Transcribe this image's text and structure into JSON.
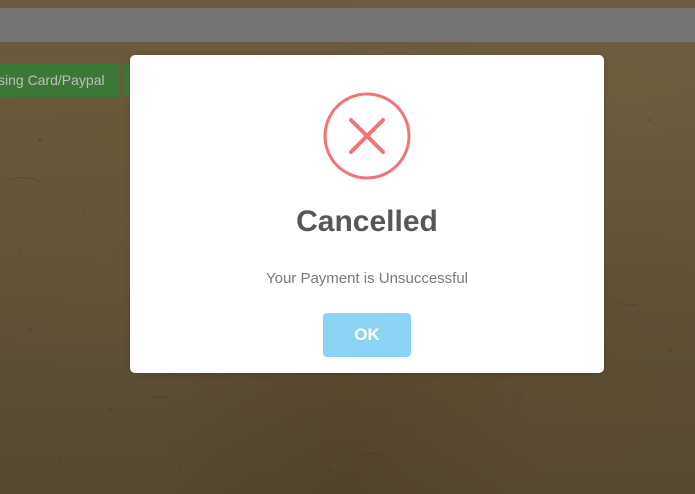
{
  "background": {
    "top_bar_color": "#979592",
    "buttons": [
      {
        "label": "sing Card/Paypal",
        "color": "#4e9a45"
      },
      {
        "label": "",
        "color": "#4e9a45"
      }
    ]
  },
  "dialog": {
    "icon": "error-x-icon",
    "icon_color": "#f27474",
    "title": "Cancelled",
    "message": "Your Payment is Unsuccessful",
    "confirm_label": "OK",
    "confirm_color": "#8cd4f5"
  }
}
